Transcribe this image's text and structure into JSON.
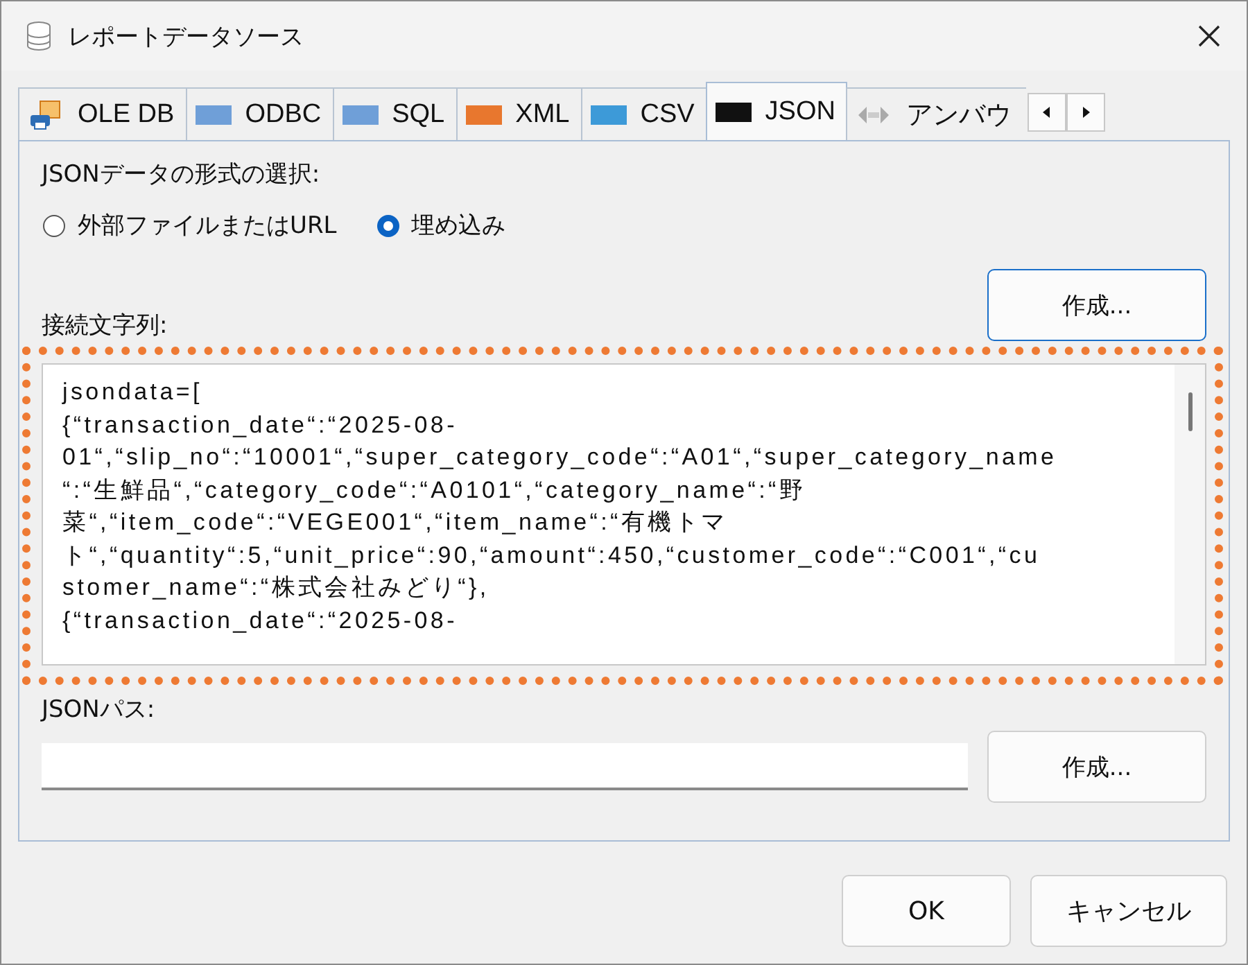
{
  "window": {
    "title": "レポートデータソース"
  },
  "tabs": [
    {
      "label": "OLE DB",
      "kind": "oledb",
      "selected": false
    },
    {
      "label": "ODBC",
      "kind": "odbc",
      "selected": false
    },
    {
      "label": "SQL",
      "kind": "sql",
      "selected": false
    },
    {
      "label": "XML",
      "kind": "xml",
      "selected": false
    },
    {
      "label": "CSV",
      "kind": "csv",
      "selected": false
    },
    {
      "label": "JSON",
      "kind": "json",
      "selected": true
    },
    {
      "label": "アンバウ",
      "kind": "unbound",
      "selected": false
    }
  ],
  "format": {
    "label": "JSONデータの形式の選択:",
    "options": [
      {
        "label": "外部ファイルまたはURL",
        "selected": false
      },
      {
        "label": "埋め込み",
        "selected": true
      }
    ]
  },
  "connection": {
    "label": "接続文字列:",
    "button": "作成...",
    "lines": [
      "jsondata=[",
      "{“transaction_date“:“2025-08-",
      "01“,“slip_no“:“10001“,“super_category_code“:“A01“,“super_category_name",
      "“:“生鮮品“,“category_code“:“A0101“,“category_name“:“野",
      "菜“,“item_code“:“VEGE001“,“item_name“:“有機トマ",
      "ト“,“quantity“:5,“unit_price“:90,“amount“:450,“customer_code“:“C001“,“cu",
      "stomer_name“:“株式会社みどり“},",
      "{“transaction_date“:“2025-08-"
    ]
  },
  "json_path": {
    "label": "JSONパス:",
    "button": "作成..."
  },
  "buttons": [
    "OK",
    "キャンセル"
  ]
}
